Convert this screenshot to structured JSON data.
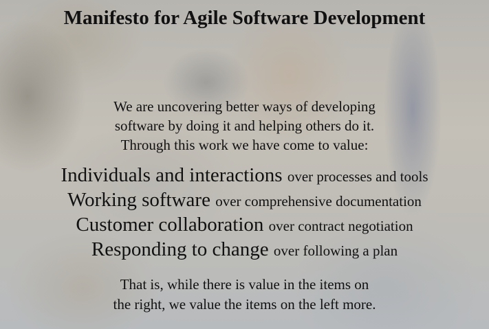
{
  "title": "Manifesto for Agile Software Development",
  "intro": [
    "We are uncovering better ways of developing",
    "software by doing it and helping others do it.",
    "Through this work we have come to value:"
  ],
  "values": [
    {
      "left": "Individuals and interactions",
      "right": "over processes and tools"
    },
    {
      "left": "Working software",
      "right": "over comprehensive documentation"
    },
    {
      "left": "Customer collaboration",
      "right": "over contract negotiation"
    },
    {
      "left": "Responding to change",
      "right": "over following a plan"
    }
  ],
  "outro": [
    "That is, while there is value in the items on",
    "the right, we value the items on the left more."
  ]
}
